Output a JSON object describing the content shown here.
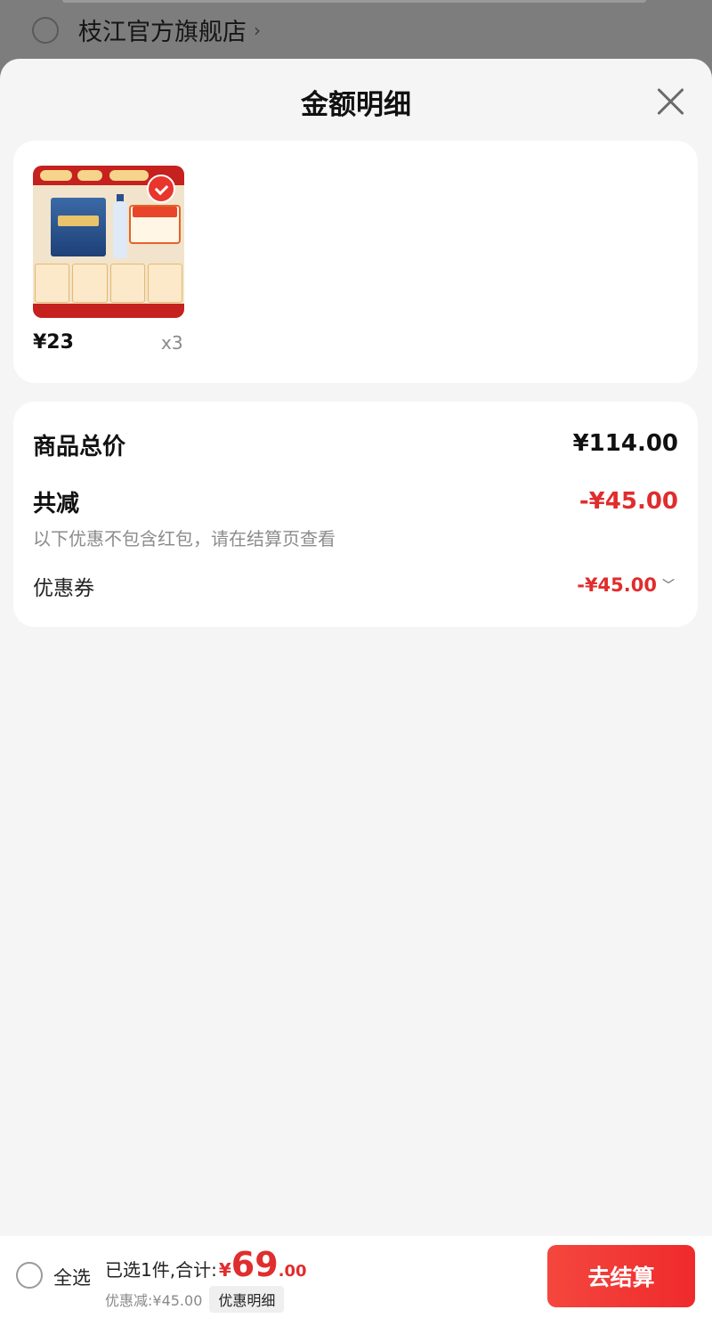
{
  "background": {
    "store_name": "枝江官方旗舰店",
    "store_chevron": "›"
  },
  "sheet": {
    "title": "金额明细",
    "close_icon": "close-icon"
  },
  "items": [
    {
      "price": "¥23",
      "quantity": "x3",
      "selected": true
    }
  ],
  "summary": {
    "total_label": "商品总价",
    "total_value": "¥114.00",
    "discount_label": "共减",
    "discount_value": "-¥45.00",
    "discount_note": "以下优惠不包含红包，请在结算页查看",
    "coupon_label": "优惠券",
    "coupon_value": "-¥45.00",
    "coupon_chevron": "﹀"
  },
  "bottom_bar": {
    "select_all_label": "全选",
    "selected_summary": "已选1件,合计:",
    "currency_symbol": "¥",
    "total_integer": "69",
    "total_decimal": ".00",
    "discount_text": "优惠减:¥45.00",
    "detail_label": "优惠明细",
    "checkout_label": "去结算"
  },
  "colors": {
    "accent_red": "#e02d2d",
    "checkout_red": "#ef2a2c",
    "sheet_bg": "#f5f5f5",
    "overlay": "#7a7a7a"
  }
}
